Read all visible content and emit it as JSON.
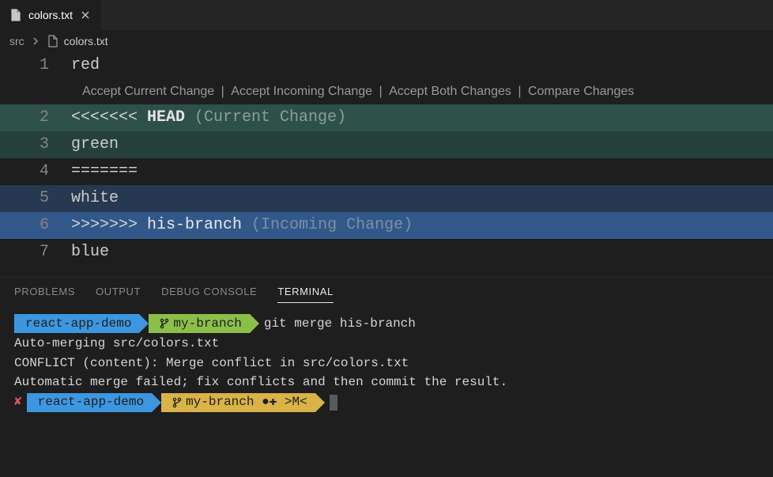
{
  "tab": {
    "filename": "colors.txt"
  },
  "breadcrumb": {
    "folder": "src",
    "file": "colors.txt"
  },
  "codelens": {
    "accept_current": "Accept Current Change",
    "accept_incoming": "Accept Incoming Change",
    "accept_both": "Accept Both Changes",
    "compare": "Compare Changes"
  },
  "lines": {
    "l1": {
      "num": "1",
      "text": "red"
    },
    "l2": {
      "num": "2",
      "marker": "<<<<<<< ",
      "ref": "HEAD",
      "label": " (Current Change)"
    },
    "l3": {
      "num": "3",
      "text": "green"
    },
    "l4": {
      "num": "4",
      "text": "======="
    },
    "l5": {
      "num": "5",
      "text": "white"
    },
    "l6": {
      "num": "6",
      "marker": ">>>>>>> ",
      "ref": "his-branch",
      "label": " (Incoming Change)"
    },
    "l7": {
      "num": "7",
      "text": "blue"
    }
  },
  "panel_tabs": {
    "problems": "PROBLEMS",
    "output": "OUTPUT",
    "debug": "DEBUG CONSOLE",
    "terminal": "TERMINAL"
  },
  "terminal": {
    "prompt1": {
      "project": "react-app-demo",
      "branch": "my-branch",
      "command": "git merge his-branch"
    },
    "out1": "Auto-merging src/colors.txt",
    "out2": "CONFLICT (content): Merge conflict in src/colors.txt",
    "out3": "Automatic merge failed; fix conflicts and then commit the result.",
    "prompt2": {
      "x": "✘",
      "project": "react-app-demo",
      "branch": "my-branch ●✚ >M<"
    }
  }
}
